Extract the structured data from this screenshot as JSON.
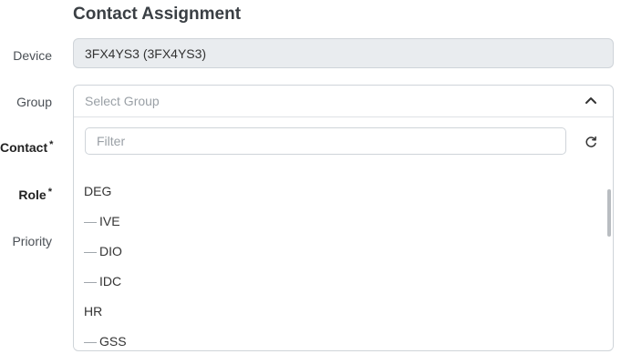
{
  "header": {
    "title": "Contact Assignment"
  },
  "form": {
    "device": {
      "label": "Device",
      "value": "3FX4YS3 (3FX4YS3)"
    },
    "group": {
      "label": "Group",
      "placeholder": "Select Group",
      "filter_placeholder": "Filter",
      "options": [
        {
          "text": "DEG",
          "child": false
        },
        {
          "text": "IVE",
          "child": true
        },
        {
          "text": "DIO",
          "child": true
        },
        {
          "text": "IDC",
          "child": true
        },
        {
          "text": "HR",
          "child": false
        },
        {
          "text": "GSS",
          "child": true
        }
      ]
    },
    "contact": {
      "label": "Contact",
      "required_mark": "*"
    },
    "role": {
      "label": "Role",
      "required_mark": "*"
    },
    "priority": {
      "label": "Priority"
    }
  },
  "icons": {
    "dropdown": "chevron-up-icon",
    "refresh": "refresh-icon"
  }
}
